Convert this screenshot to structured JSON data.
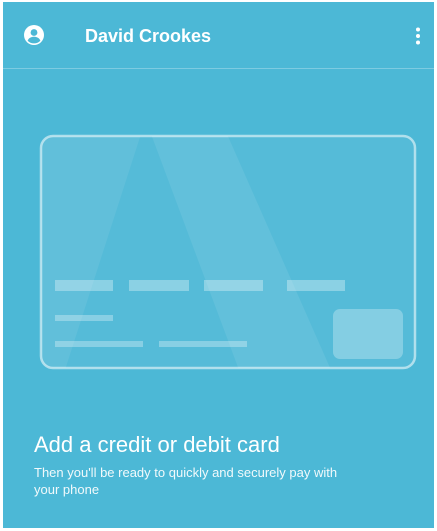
{
  "header": {
    "account_icon": "account-circle-icon",
    "user_name": "David Crookes",
    "menu_icon": "more-vert-icon"
  },
  "card_placeholder": {
    "icon": "credit-card-illustration"
  },
  "promo": {
    "title": "Add a credit or debit card",
    "body": "Then you'll be ready to quickly and securely pay with your phone"
  },
  "colors": {
    "background": "#4cb8d6",
    "text": "#ffffff"
  }
}
